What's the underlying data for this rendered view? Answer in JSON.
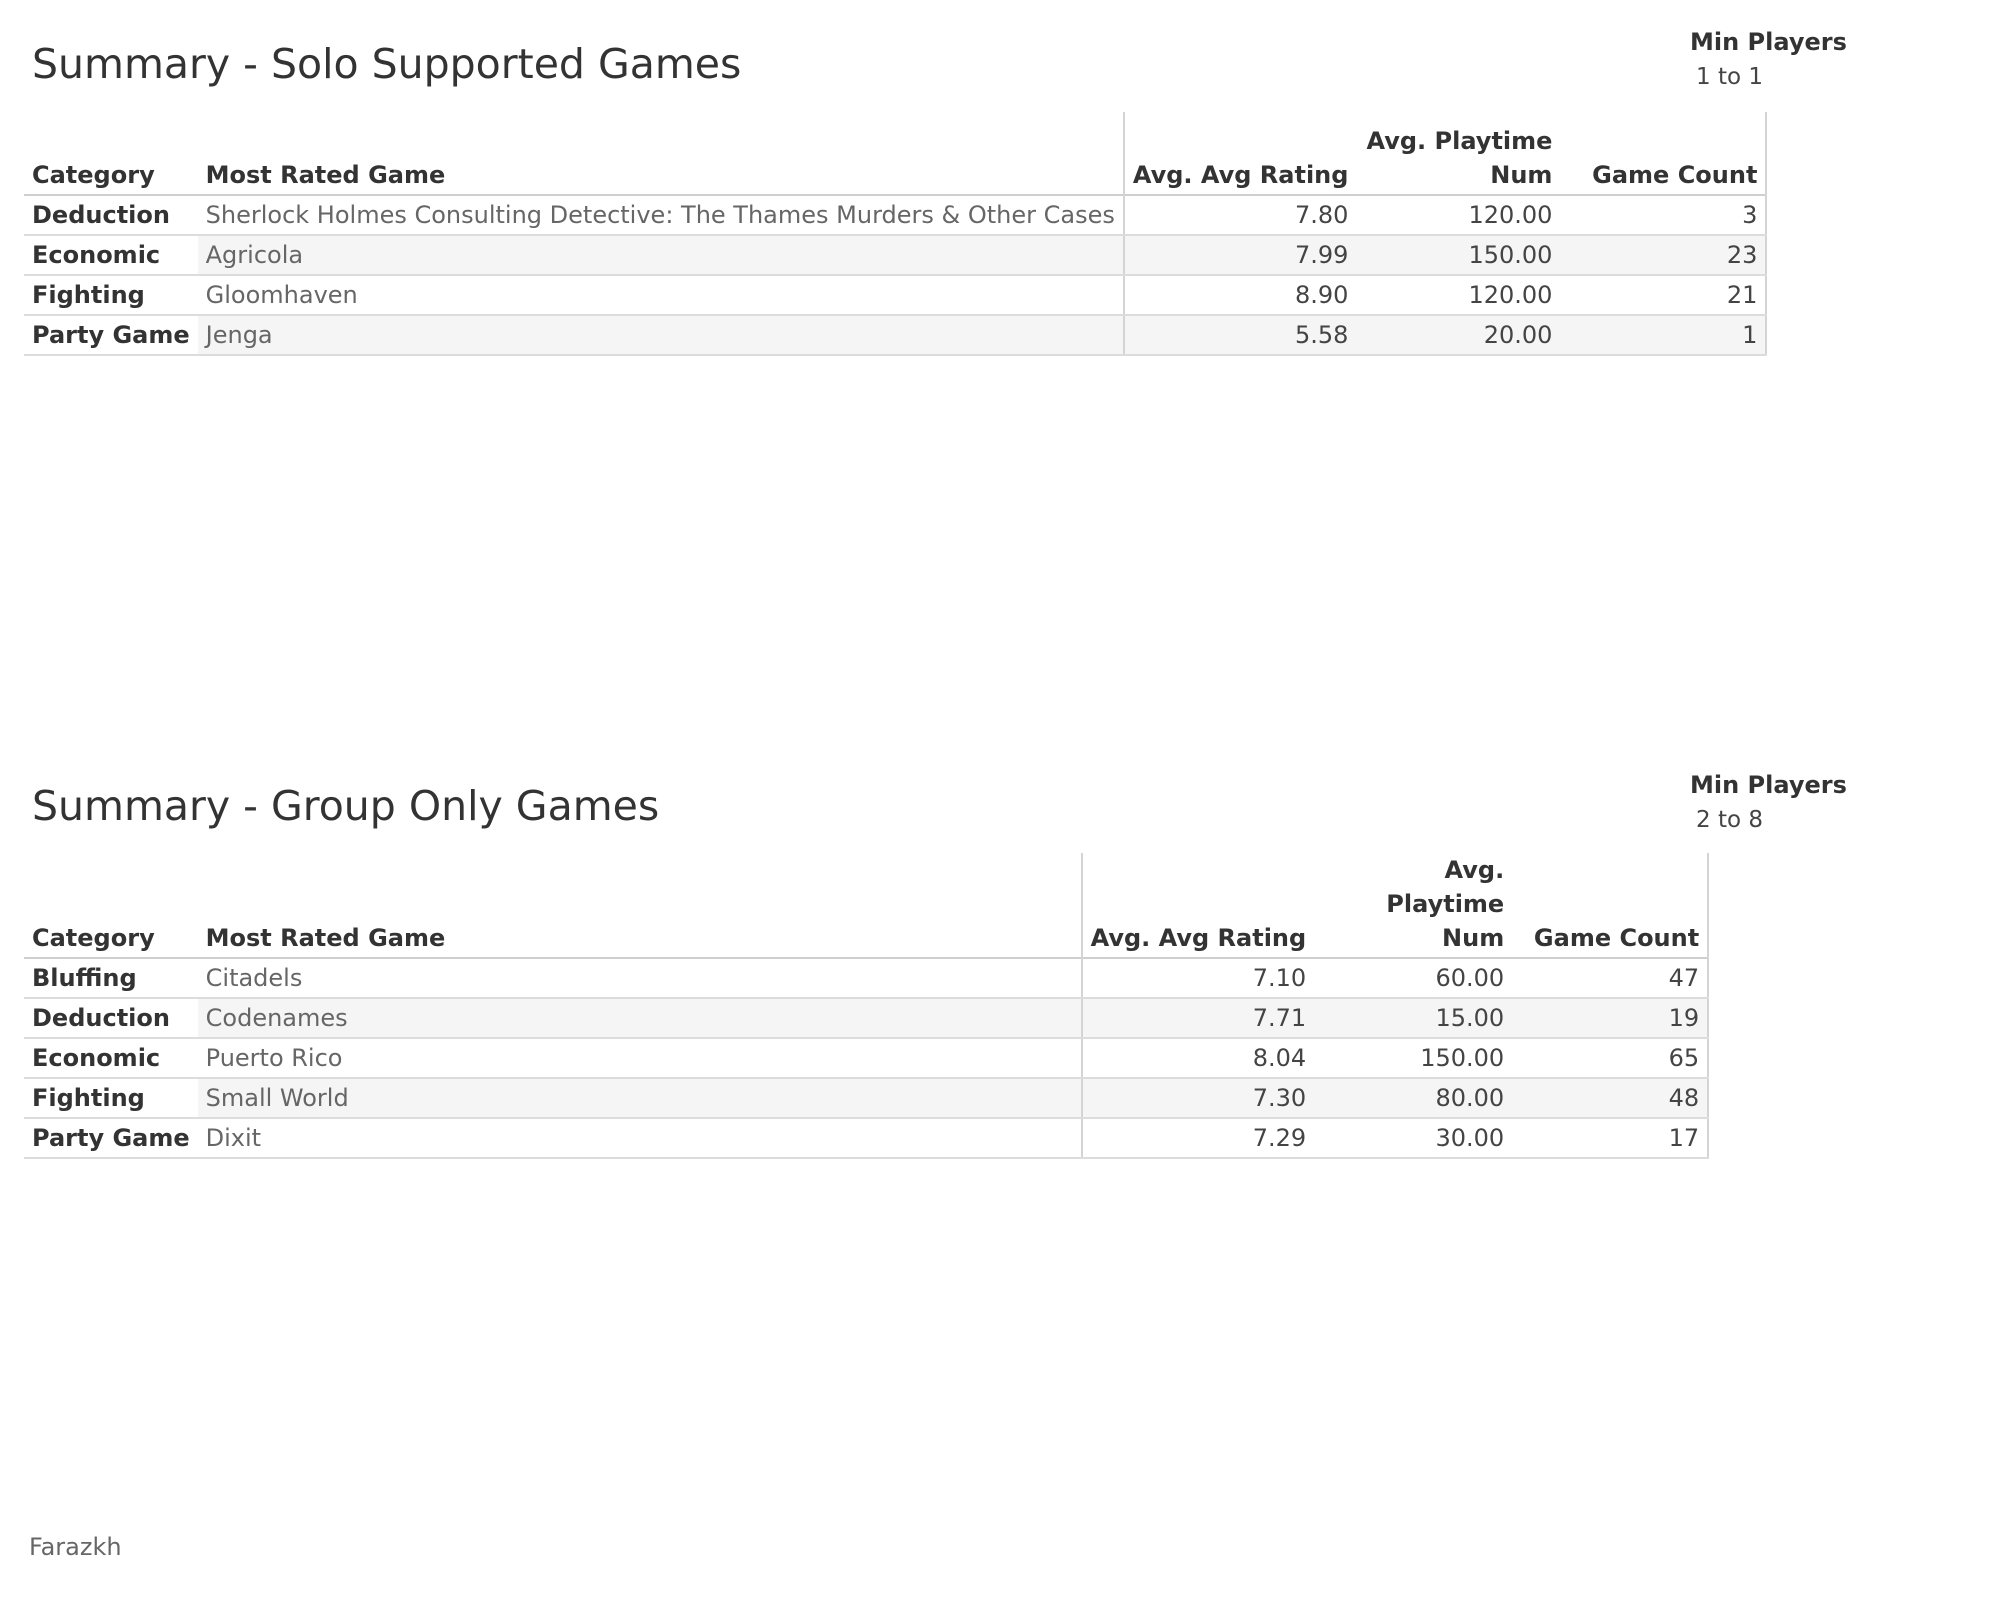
{
  "chart_data": [
    {
      "type": "table",
      "title": "Summary - Solo Supported Games",
      "filter": {
        "label": "Min Players",
        "value": "1 to 1"
      },
      "columns": [
        "Category",
        "Most Rated Game",
        "Avg. Avg Rating",
        "Avg. Playtime Num",
        "Game Count"
      ],
      "rows": [
        [
          "Deduction",
          "Sherlock Holmes Consulting Detective: The Thames Murders & Other Cases",
          "7.80",
          "120.00",
          "3"
        ],
        [
          "Economic",
          "Agricola",
          "7.99",
          "150.00",
          "23"
        ],
        [
          "Fighting",
          "Gloomhaven",
          "8.90",
          "120.00",
          "21"
        ],
        [
          "Party Game",
          "Jenga",
          "5.58",
          "20.00",
          "1"
        ]
      ]
    },
    {
      "type": "table",
      "title": "Summary - Group Only Games",
      "filter": {
        "label": "Min Players",
        "value": "2 to 8"
      },
      "columns": [
        "Category",
        "Most Rated Game",
        "Avg. Avg Rating",
        "Avg. Playtime Num",
        "Game Count"
      ],
      "rows": [
        [
          "Bluffing",
          "Citadels",
          "7.10",
          "60.00",
          "47"
        ],
        [
          "Deduction",
          "Codenames",
          "7.71",
          "15.00",
          "19"
        ],
        [
          "Economic",
          "Puerto Rico",
          "8.04",
          "150.00",
          "65"
        ],
        [
          "Fighting",
          "Small World",
          "7.30",
          "80.00",
          "48"
        ],
        [
          "Party Game",
          "Dixit",
          "7.29",
          "30.00",
          "17"
        ]
      ]
    }
  ],
  "footer": {
    "author": "Farazkh"
  }
}
